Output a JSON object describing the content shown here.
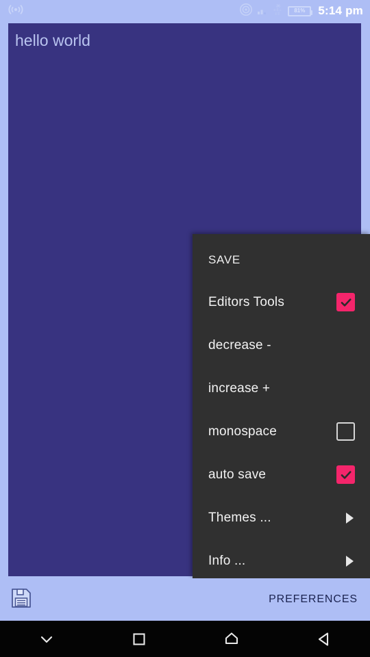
{
  "status_bar": {
    "broadcast_icon": "broadcast-icon",
    "cast_icon": "cast-icon",
    "signal_icon": "signal-bars-icon",
    "sim_icon": "dual-sim-icon",
    "battery_icon": "battery-icon",
    "battery_text": "81%",
    "clock": "5:14 pm"
  },
  "editor": {
    "text": "hello world"
  },
  "menu": {
    "items": [
      {
        "label": "SAVE",
        "type": "action",
        "name": "save"
      },
      {
        "label": "Editors Tools",
        "type": "checkbox",
        "name": "editors-tools",
        "checked": true
      },
      {
        "label": "decrease -",
        "type": "action",
        "name": "decrease"
      },
      {
        "label": "increase +",
        "type": "action",
        "name": "increase"
      },
      {
        "label": "monospace",
        "type": "checkbox",
        "name": "monospace",
        "checked": false
      },
      {
        "label": "auto save",
        "type": "checkbox",
        "name": "auto-save",
        "checked": true
      },
      {
        "label": "Themes ...",
        "type": "submenu",
        "name": "themes"
      },
      {
        "label": "Info ...",
        "type": "submenu",
        "name": "info"
      }
    ]
  },
  "bottom_bar": {
    "save_icon": "floppy-disk-save-icon",
    "preferences_label": "PREFERENCES"
  },
  "nav_bar": {
    "items": [
      {
        "name": "hide-keyboard-icon",
        "label": "hide keyboard"
      },
      {
        "name": "recents-icon",
        "label": "recent apps"
      },
      {
        "name": "home-icon",
        "label": "home"
      },
      {
        "name": "back-icon",
        "label": "back"
      }
    ]
  },
  "colors": {
    "page_background": "#aebef5",
    "editor_background": "#383380",
    "editor_text": "#b9c4ef",
    "menu_background": "#303030",
    "menu_text": "#f2f2f2",
    "accent_pink": "#f4256b",
    "nav_background": "#040404",
    "preferences_text": "#1b2350"
  }
}
